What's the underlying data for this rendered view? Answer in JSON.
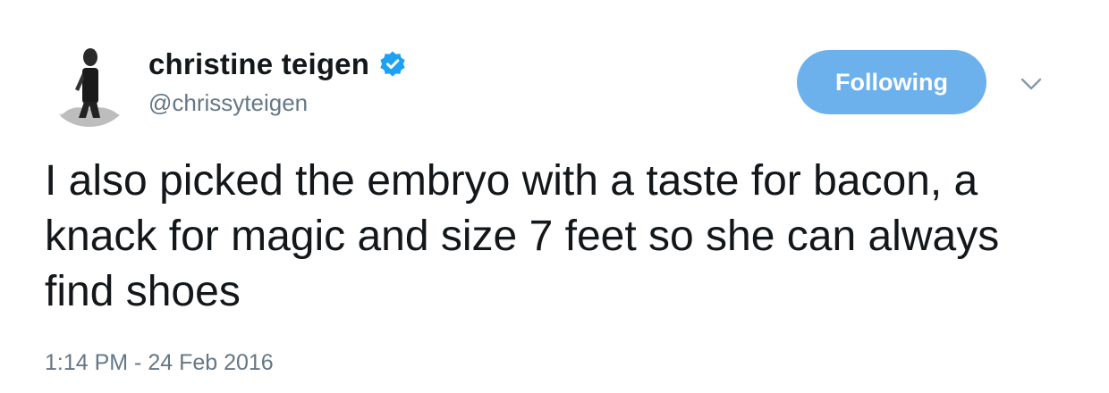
{
  "author": {
    "display_name": "christine teigen",
    "handle": "@chrissyteigen",
    "verified_icon": "verified-badge-icon",
    "avatar_icon": "profile-photo"
  },
  "actions": {
    "follow_label": "Following",
    "menu_icon": "chevron-down-icon"
  },
  "tweet": {
    "text": "I also picked the embryo with a taste for bacon, a knack for magic and size 7 feet so she can always find shoes",
    "timestamp": "1:14 PM - 24 Feb 2016"
  },
  "colors": {
    "follow_button_bg": "#6cb1eb",
    "verified_blue": "#1da1f2",
    "secondary_text": "#657786",
    "primary_text": "#14171a"
  }
}
